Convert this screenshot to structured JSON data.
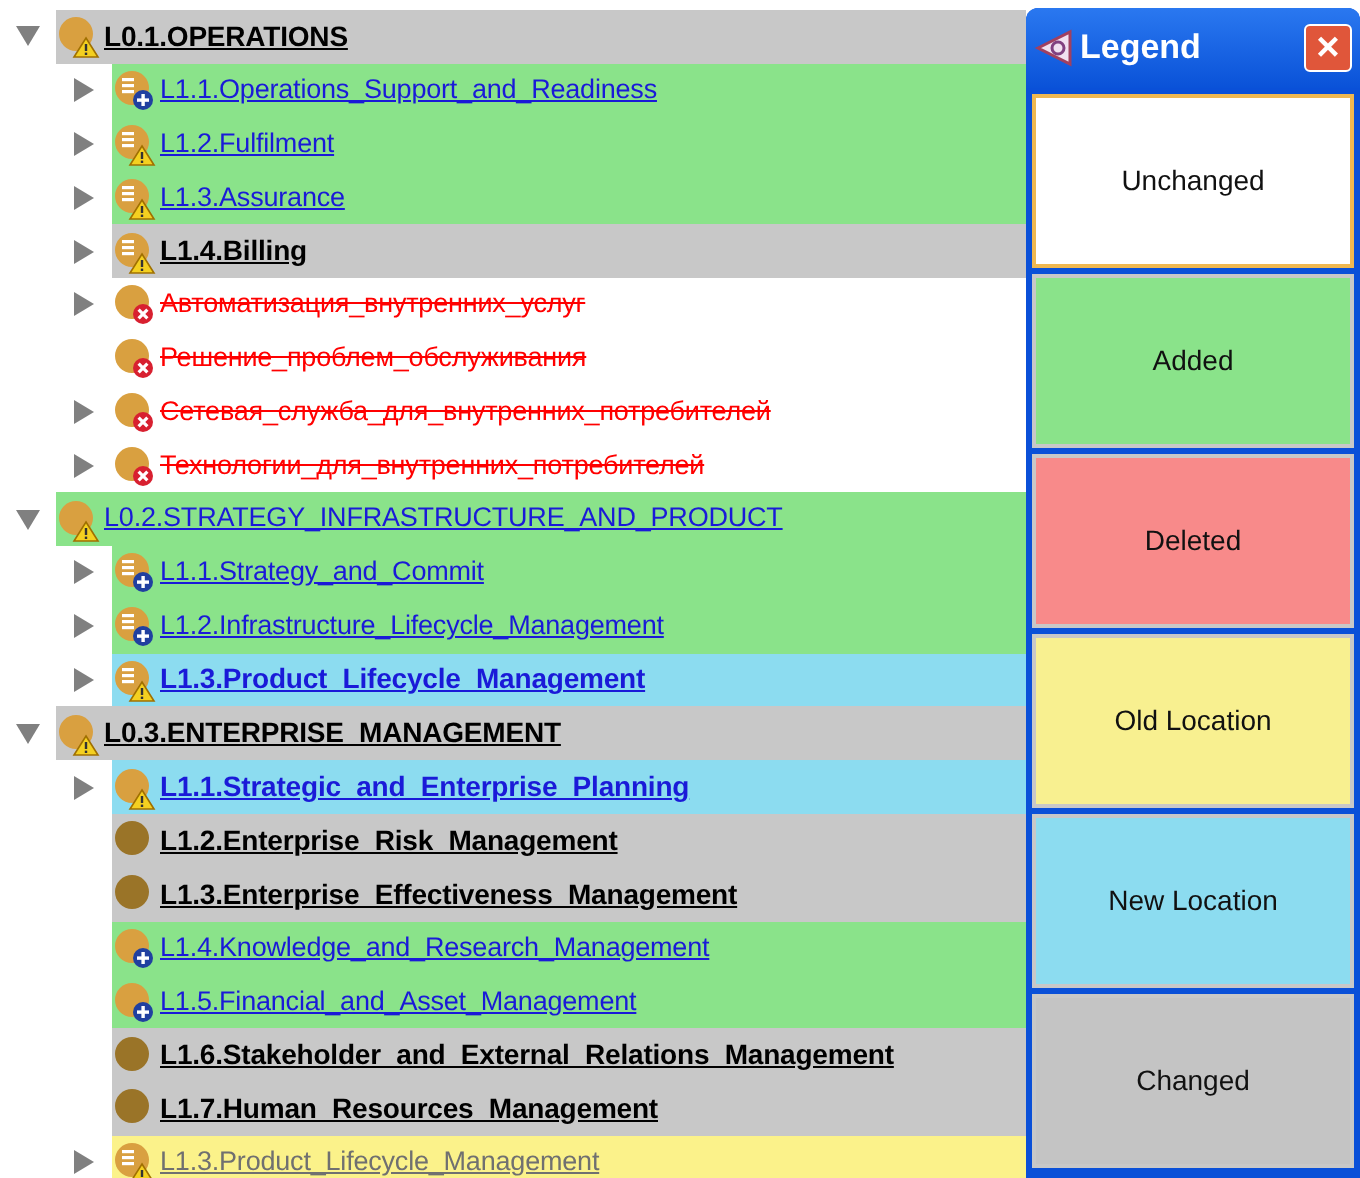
{
  "tree": [
    {
      "label": "L0.1.OPERATIONS",
      "color": "#c8c8c8",
      "deleted": false,
      "bold": true,
      "expanded": true,
      "kind": "warn",
      "children": [
        {
          "label": "L1.1.Operations_Support_and_Readiness",
          "color": "#8ae38a",
          "deleted": false,
          "bold": false,
          "expanded": false,
          "kind": "listplus"
        },
        {
          "label": "L1.2.Fulfilment",
          "color": "#8ae38a",
          "deleted": false,
          "bold": false,
          "expanded": false,
          "kind": "listwarn"
        },
        {
          "label": "L1.3.Assurance",
          "color": "#8ae38a",
          "deleted": false,
          "bold": false,
          "expanded": false,
          "kind": "listwarn"
        },
        {
          "label": "L1.4.Billing",
          "color": "#c8c8c8",
          "deleted": false,
          "bold": true,
          "expanded": false,
          "kind": "listwarn"
        },
        {
          "label": "Автоматизация_внутренних_услуг",
          "color": "#ffffff",
          "deleted": true,
          "bold": false,
          "expanded": false,
          "kind": "cross"
        },
        {
          "label": "Решение_проблем_обслуживания",
          "color": "#ffffff",
          "deleted": true,
          "bold": false,
          "kind": "cross"
        },
        {
          "label": "Сетевая_служба_для_внутренних_потребителей",
          "color": "#ffffff",
          "deleted": true,
          "bold": false,
          "expanded": false,
          "kind": "cross"
        },
        {
          "label": "Технологии_для_внутренних_потребителей",
          "color": "#ffffff",
          "deleted": true,
          "bold": false,
          "expanded": false,
          "kind": "cross"
        }
      ]
    },
    {
      "label": "L0.2.STRATEGY_INFRASTRUCTURE_AND_PRODUCT",
      "color": "#8ae38a",
      "deleted": false,
      "bold": false,
      "expanded": true,
      "kind": "warn",
      "children": [
        {
          "label": "L1.1.Strategy_and_Commit",
          "color": "#8ae38a",
          "deleted": false,
          "bold": false,
          "expanded": false,
          "kind": "listplus"
        },
        {
          "label": "L1.2.Infrastructure_Lifecycle_Management",
          "color": "#8ae38a",
          "deleted": false,
          "bold": false,
          "expanded": false,
          "kind": "listplus"
        },
        {
          "label": "L1.3.Product_Lifecycle_Management",
          "color": "#8cdcf0",
          "deleted": false,
          "bold": true,
          "expanded": false,
          "kind": "listwarn"
        }
      ]
    },
    {
      "label": "L0.3.ENTERPRISE_MANAGEMENT",
      "color": "#c8c8c8",
      "deleted": false,
      "bold": true,
      "expanded": true,
      "kind": "warn",
      "children": [
        {
          "label": "L1.1.Strategic_and_Enterprise_Planning",
          "color": "#8cdcf0",
          "deleted": false,
          "bold": true,
          "expanded": false,
          "kind": "warn"
        },
        {
          "label": "L1.2.Enterprise_Risk_Management",
          "color": "#c8c8c8",
          "deleted": false,
          "bold": true,
          "kind": "dot"
        },
        {
          "label": "L1.3.Enterprise_Effectiveness_Management",
          "color": "#c8c8c8",
          "deleted": false,
          "bold": true,
          "kind": "dot"
        },
        {
          "label": "L1.4.Knowledge_and_Research_Management",
          "color": "#8ae38a",
          "deleted": false,
          "bold": false,
          "kind": "plus"
        },
        {
          "label": "L1.5.Financial_and_Asset_Management",
          "color": "#8ae38a",
          "deleted": false,
          "bold": false,
          "kind": "plus"
        },
        {
          "label": "L1.6.Stakeholder_and_External_Relations_Management",
          "color": "#c8c8c8",
          "deleted": false,
          "bold": true,
          "kind": "dot"
        },
        {
          "label": "L1.7.Human_Resources_Management",
          "color": "#c8c8c8",
          "deleted": false,
          "bold": true,
          "kind": "dot"
        },
        {
          "label": "L1.3.Product_Lifecycle_Management",
          "color": "#fbf28a",
          "deleted": false,
          "bold": false,
          "expanded": false,
          "kind": "listwarn"
        }
      ]
    }
  ],
  "legend": {
    "title": "Legend",
    "close": "×",
    "items": [
      {
        "label": "Unchanged",
        "color": "#ffffff",
        "focused": true
      },
      {
        "label": "Added",
        "color": "#8ae38a",
        "focused": false
      },
      {
        "label": "Deleted",
        "color": "#f88a8a",
        "focused": false
      },
      {
        "label": "Old Location",
        "color": "#f8f090",
        "focused": false
      },
      {
        "label": "New Location",
        "color": "#8cdcf0",
        "focused": false
      },
      {
        "label": "Changed",
        "color": "#c4c4c4",
        "focused": false
      }
    ]
  }
}
